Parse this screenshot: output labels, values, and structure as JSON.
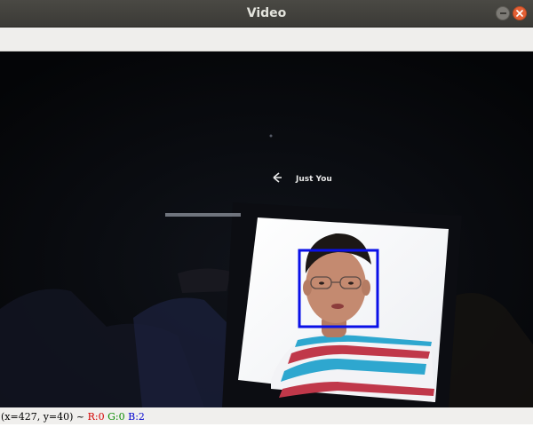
{
  "window": {
    "title": "Video"
  },
  "video": {
    "phone_app_back_icon": "arrow-left-icon",
    "phone_app_title": "Just You",
    "detection_box_color": "#0a10e8"
  },
  "statusbar": {
    "coords": "(x=427, y=40) ~",
    "r": "R:0",
    "g": "G:0",
    "b": "B:2"
  }
}
